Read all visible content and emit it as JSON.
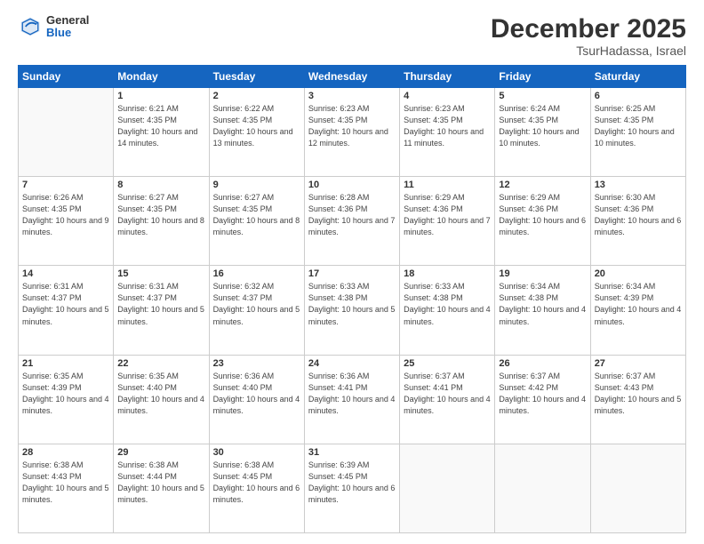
{
  "header": {
    "logo_general": "General",
    "logo_blue": "Blue",
    "month_title": "December 2025",
    "location": "TsurHadassa, Israel"
  },
  "weekdays": [
    "Sunday",
    "Monday",
    "Tuesday",
    "Wednesday",
    "Thursday",
    "Friday",
    "Saturday"
  ],
  "weeks": [
    [
      {
        "day": "",
        "sunrise": "",
        "sunset": "",
        "daylight": ""
      },
      {
        "day": "1",
        "sunrise": "Sunrise: 6:21 AM",
        "sunset": "Sunset: 4:35 PM",
        "daylight": "Daylight: 10 hours and 14 minutes."
      },
      {
        "day": "2",
        "sunrise": "Sunrise: 6:22 AM",
        "sunset": "Sunset: 4:35 PM",
        "daylight": "Daylight: 10 hours and 13 minutes."
      },
      {
        "day": "3",
        "sunrise": "Sunrise: 6:23 AM",
        "sunset": "Sunset: 4:35 PM",
        "daylight": "Daylight: 10 hours and 12 minutes."
      },
      {
        "day": "4",
        "sunrise": "Sunrise: 6:23 AM",
        "sunset": "Sunset: 4:35 PM",
        "daylight": "Daylight: 10 hours and 11 minutes."
      },
      {
        "day": "5",
        "sunrise": "Sunrise: 6:24 AM",
        "sunset": "Sunset: 4:35 PM",
        "daylight": "Daylight: 10 hours and 10 minutes."
      },
      {
        "day": "6",
        "sunrise": "Sunrise: 6:25 AM",
        "sunset": "Sunset: 4:35 PM",
        "daylight": "Daylight: 10 hours and 10 minutes."
      }
    ],
    [
      {
        "day": "7",
        "sunrise": "Sunrise: 6:26 AM",
        "sunset": "Sunset: 4:35 PM",
        "daylight": "Daylight: 10 hours and 9 minutes."
      },
      {
        "day": "8",
        "sunrise": "Sunrise: 6:27 AM",
        "sunset": "Sunset: 4:35 PM",
        "daylight": "Daylight: 10 hours and 8 minutes."
      },
      {
        "day": "9",
        "sunrise": "Sunrise: 6:27 AM",
        "sunset": "Sunset: 4:35 PM",
        "daylight": "Daylight: 10 hours and 8 minutes."
      },
      {
        "day": "10",
        "sunrise": "Sunrise: 6:28 AM",
        "sunset": "Sunset: 4:36 PM",
        "daylight": "Daylight: 10 hours and 7 minutes."
      },
      {
        "day": "11",
        "sunrise": "Sunrise: 6:29 AM",
        "sunset": "Sunset: 4:36 PM",
        "daylight": "Daylight: 10 hours and 7 minutes."
      },
      {
        "day": "12",
        "sunrise": "Sunrise: 6:29 AM",
        "sunset": "Sunset: 4:36 PM",
        "daylight": "Daylight: 10 hours and 6 minutes."
      },
      {
        "day": "13",
        "sunrise": "Sunrise: 6:30 AM",
        "sunset": "Sunset: 4:36 PM",
        "daylight": "Daylight: 10 hours and 6 minutes."
      }
    ],
    [
      {
        "day": "14",
        "sunrise": "Sunrise: 6:31 AM",
        "sunset": "Sunset: 4:37 PM",
        "daylight": "Daylight: 10 hours and 5 minutes."
      },
      {
        "day": "15",
        "sunrise": "Sunrise: 6:31 AM",
        "sunset": "Sunset: 4:37 PM",
        "daylight": "Daylight: 10 hours and 5 minutes."
      },
      {
        "day": "16",
        "sunrise": "Sunrise: 6:32 AM",
        "sunset": "Sunset: 4:37 PM",
        "daylight": "Daylight: 10 hours and 5 minutes."
      },
      {
        "day": "17",
        "sunrise": "Sunrise: 6:33 AM",
        "sunset": "Sunset: 4:38 PM",
        "daylight": "Daylight: 10 hours and 5 minutes."
      },
      {
        "day": "18",
        "sunrise": "Sunrise: 6:33 AM",
        "sunset": "Sunset: 4:38 PM",
        "daylight": "Daylight: 10 hours and 4 minutes."
      },
      {
        "day": "19",
        "sunrise": "Sunrise: 6:34 AM",
        "sunset": "Sunset: 4:38 PM",
        "daylight": "Daylight: 10 hours and 4 minutes."
      },
      {
        "day": "20",
        "sunrise": "Sunrise: 6:34 AM",
        "sunset": "Sunset: 4:39 PM",
        "daylight": "Daylight: 10 hours and 4 minutes."
      }
    ],
    [
      {
        "day": "21",
        "sunrise": "Sunrise: 6:35 AM",
        "sunset": "Sunset: 4:39 PM",
        "daylight": "Daylight: 10 hours and 4 minutes."
      },
      {
        "day": "22",
        "sunrise": "Sunrise: 6:35 AM",
        "sunset": "Sunset: 4:40 PM",
        "daylight": "Daylight: 10 hours and 4 minutes."
      },
      {
        "day": "23",
        "sunrise": "Sunrise: 6:36 AM",
        "sunset": "Sunset: 4:40 PM",
        "daylight": "Daylight: 10 hours and 4 minutes."
      },
      {
        "day": "24",
        "sunrise": "Sunrise: 6:36 AM",
        "sunset": "Sunset: 4:41 PM",
        "daylight": "Daylight: 10 hours and 4 minutes."
      },
      {
        "day": "25",
        "sunrise": "Sunrise: 6:37 AM",
        "sunset": "Sunset: 4:41 PM",
        "daylight": "Daylight: 10 hours and 4 minutes."
      },
      {
        "day": "26",
        "sunrise": "Sunrise: 6:37 AM",
        "sunset": "Sunset: 4:42 PM",
        "daylight": "Daylight: 10 hours and 4 minutes."
      },
      {
        "day": "27",
        "sunrise": "Sunrise: 6:37 AM",
        "sunset": "Sunset: 4:43 PM",
        "daylight": "Daylight: 10 hours and 5 minutes."
      }
    ],
    [
      {
        "day": "28",
        "sunrise": "Sunrise: 6:38 AM",
        "sunset": "Sunset: 4:43 PM",
        "daylight": "Daylight: 10 hours and 5 minutes."
      },
      {
        "day": "29",
        "sunrise": "Sunrise: 6:38 AM",
        "sunset": "Sunset: 4:44 PM",
        "daylight": "Daylight: 10 hours and 5 minutes."
      },
      {
        "day": "30",
        "sunrise": "Sunrise: 6:38 AM",
        "sunset": "Sunset: 4:45 PM",
        "daylight": "Daylight: 10 hours and 6 minutes."
      },
      {
        "day": "31",
        "sunrise": "Sunrise: 6:39 AM",
        "sunset": "Sunset: 4:45 PM",
        "daylight": "Daylight: 10 hours and 6 minutes."
      },
      {
        "day": "",
        "sunrise": "",
        "sunset": "",
        "daylight": ""
      },
      {
        "day": "",
        "sunrise": "",
        "sunset": "",
        "daylight": ""
      },
      {
        "day": "",
        "sunrise": "",
        "sunset": "",
        "daylight": ""
      }
    ]
  ]
}
